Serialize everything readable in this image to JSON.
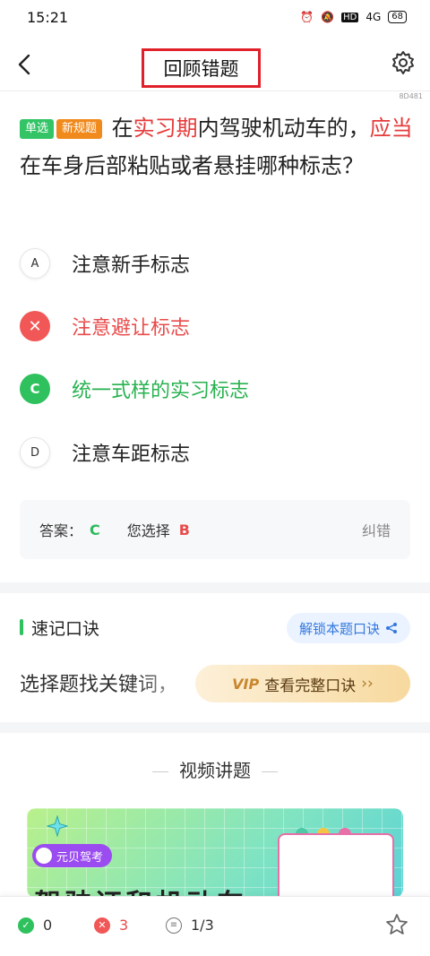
{
  "status_bar": {
    "time": "15:21",
    "network": "4G",
    "battery": "68"
  },
  "header": {
    "title": "回顾错题",
    "question_id": "8D481"
  },
  "question": {
    "tag_type": "单选",
    "tag_new": "新规题",
    "text_parts": [
      "在",
      "实习期",
      "内驾驶机动车的，",
      "应当",
      "在车身后部粘贴或者悬挂哪种标志？"
    ]
  },
  "options": [
    {
      "key": "A",
      "text": "注意新手标志",
      "state": "plain"
    },
    {
      "key": "✕",
      "text": "注意避让标志",
      "state": "wrong"
    },
    {
      "key": "C",
      "text": "统一式样的实习标志",
      "state": "right"
    },
    {
      "key": "D",
      "text": "注意车距标志",
      "state": "plain"
    }
  ],
  "answer": {
    "label": "答案：",
    "correct": "C",
    "chosen_label": "您选择",
    "chosen": "B",
    "report": "纠错"
  },
  "memo": {
    "title": "速记口诀",
    "unlock": "解锁本题口诀",
    "text": "选择题找关键词，",
    "vip_mark": "VIP",
    "vip_label": "查看完整口诀"
  },
  "video": {
    "section_title": "视频讲题",
    "brand": "元贝驾考",
    "card_title": "驾驶证和机动车"
  },
  "bottom": {
    "correct_count": "0",
    "wrong_count": "3",
    "progress": "1/3"
  },
  "colors": {
    "accent_green": "#2ec15d",
    "error_red": "#e84b4b",
    "highlight_box": "#e0202a"
  }
}
